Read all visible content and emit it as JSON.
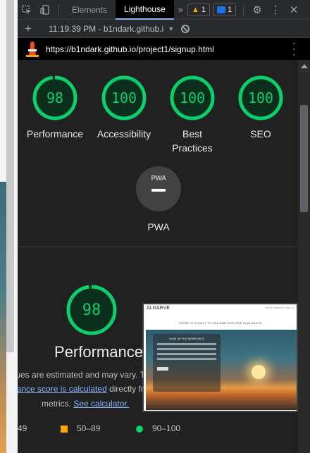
{
  "devtools": {
    "tabs": [
      {
        "label": "Elements"
      },
      {
        "label": "Lighthouse"
      }
    ],
    "warning_count": "1",
    "message_count": "1"
  },
  "toolbar": {
    "report_label": "11:19:39 PM - b1ndark.github.i"
  },
  "url": "https://b1ndark.github.io/project1/signup.html",
  "categories": [
    {
      "label": "Performance",
      "score": "98",
      "value": 98
    },
    {
      "label": "Accessibility",
      "score": "100",
      "value": 100
    },
    {
      "label": "Best Practices",
      "score": "100",
      "value": 100
    },
    {
      "label": "SEO",
      "score": "100",
      "value": 100
    }
  ],
  "pwa": {
    "label": "PWA",
    "badge": "PWA"
  },
  "performance": {
    "score": "98",
    "title": "Performance",
    "desc_line1": "alues are estimated and may vary. T",
    "desc_line2_link": "nance score is calculated",
    "desc_line2_rest": " directly fr",
    "desc_line3_text": "metrics. ",
    "desc_line3_link": "See calculator."
  },
  "legend": {
    "fail": "49",
    "average": "50–89",
    "pass": "90–100"
  },
  "thumbnail": {
    "brand": "ALGARVE",
    "nav": "Home  Watches  Sign In",
    "tagline": "THERE IS PLENTY TO SEE AND EXPLORE IN ALGARVE",
    "form_title": "SIGN UP FOR MORE INFO"
  },
  "colors": {
    "pass": "#0cce6b",
    "average": "#ffa400",
    "background": "#212121"
  }
}
